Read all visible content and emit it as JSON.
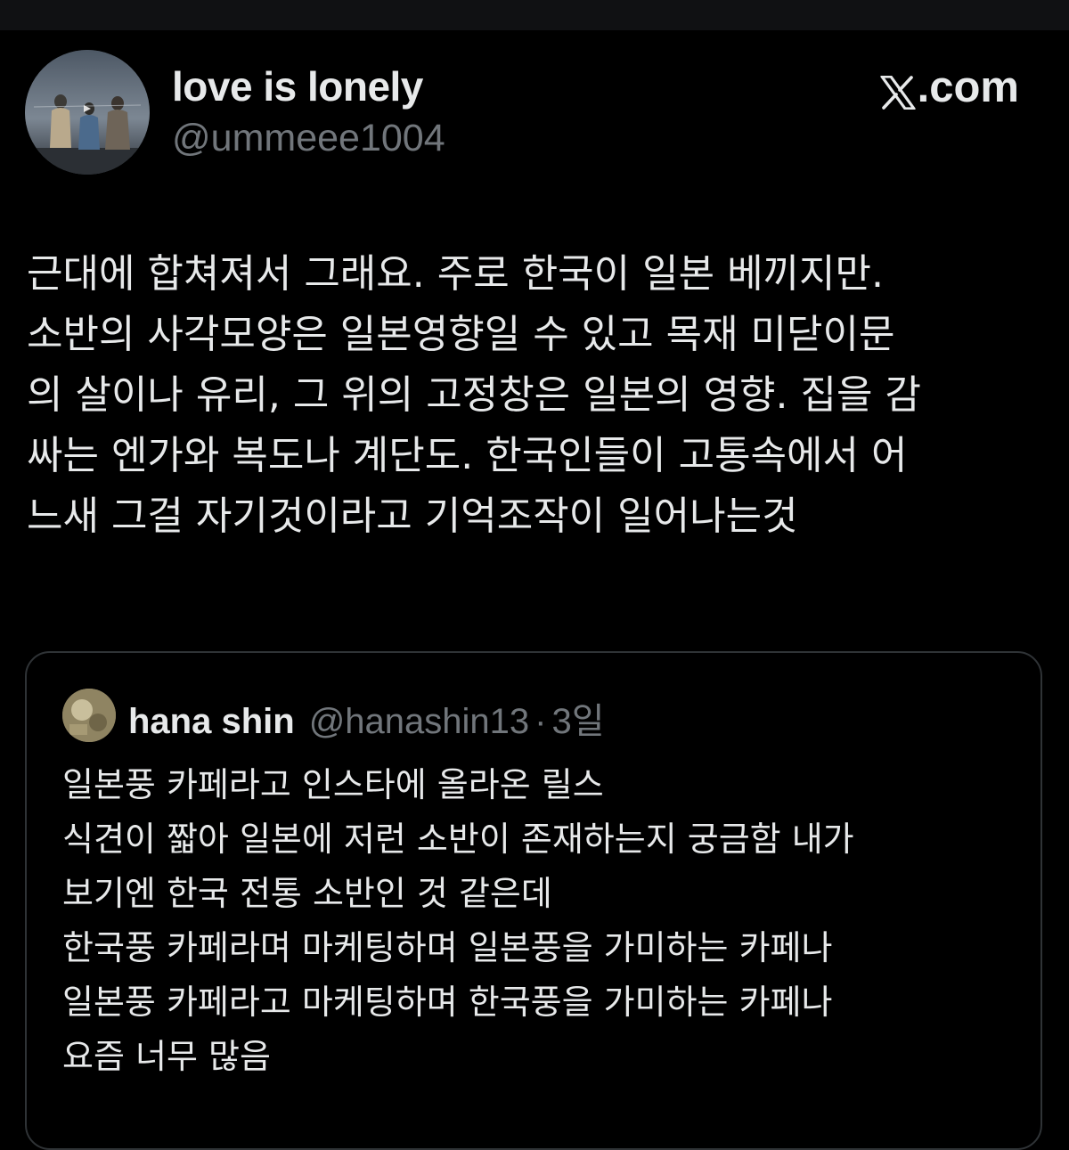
{
  "tweet": {
    "display_name": "love is lonely",
    "handle": "@ummeee1004",
    "source": ".com",
    "source_icon": "x-logo-icon",
    "text_lines": [
      "근대에 합쳐져서 그래요. 주로 한국이 일본 베끼지만.",
      "소반의 사각모양은 일본영향일 수 있고 목재 미닫이문",
      "의 살이나 유리, 그 위의 고정창은 일본의 영향. 집을 감",
      "싸는 엔가와 복도나 계단도. 한국인들이 고통속에서 어",
      "느새 그걸 자기것이라고 기억조작이 일어나는것"
    ]
  },
  "quote": {
    "display_name": "hana shin",
    "handle": "@hanashin13",
    "separator": "·",
    "time": "3일",
    "text_lines": [
      "일본풍 카페라고 인스타에 올라온 릴스",
      "식견이 짧아 일본에 저런 소반이 존재하는지 궁금함 내가",
      "보기엔 한국 전통 소반인 것 같은데",
      "한국풍 카페라며 마케팅하며 일본풍을 가미하는 카페나",
      "일본풍 카페라고 마케팅하며 한국풍을 가미하는 카페나",
      "요즘 너무 많음"
    ]
  },
  "colors": {
    "background": "#000000",
    "text_primary": "#e7e9ea",
    "text_secondary": "#71767b",
    "border": "#2f3336"
  }
}
